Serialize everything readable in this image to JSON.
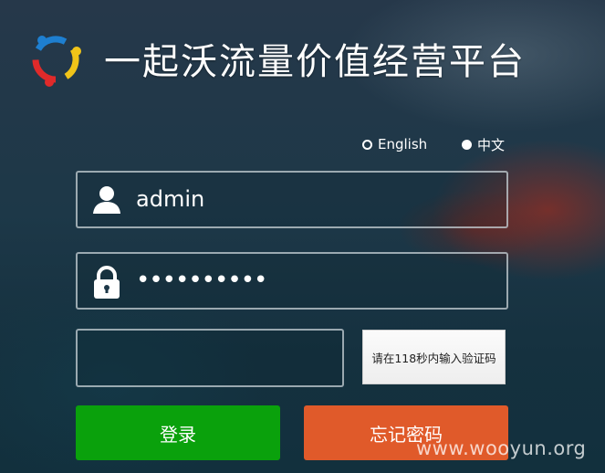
{
  "header": {
    "logo_icon": "platform-logo-icon",
    "title": "一起沃流量价值经营平台"
  },
  "language": {
    "english_label": "English",
    "chinese_label": "中文",
    "selected": "中文"
  },
  "form": {
    "username_value": "admin",
    "username_icon": "user-icon",
    "password_value": "••••••••••",
    "password_icon": "lock-icon",
    "captcha_value": "",
    "captcha_button_label": "请在118秒内输入验证码"
  },
  "buttons": {
    "login_label": "登录",
    "forgot_label": "忘记密码"
  },
  "watermark": "www.wooyun.org",
  "colors": {
    "login": "#0aa10c",
    "forgot": "#e05a2a"
  }
}
